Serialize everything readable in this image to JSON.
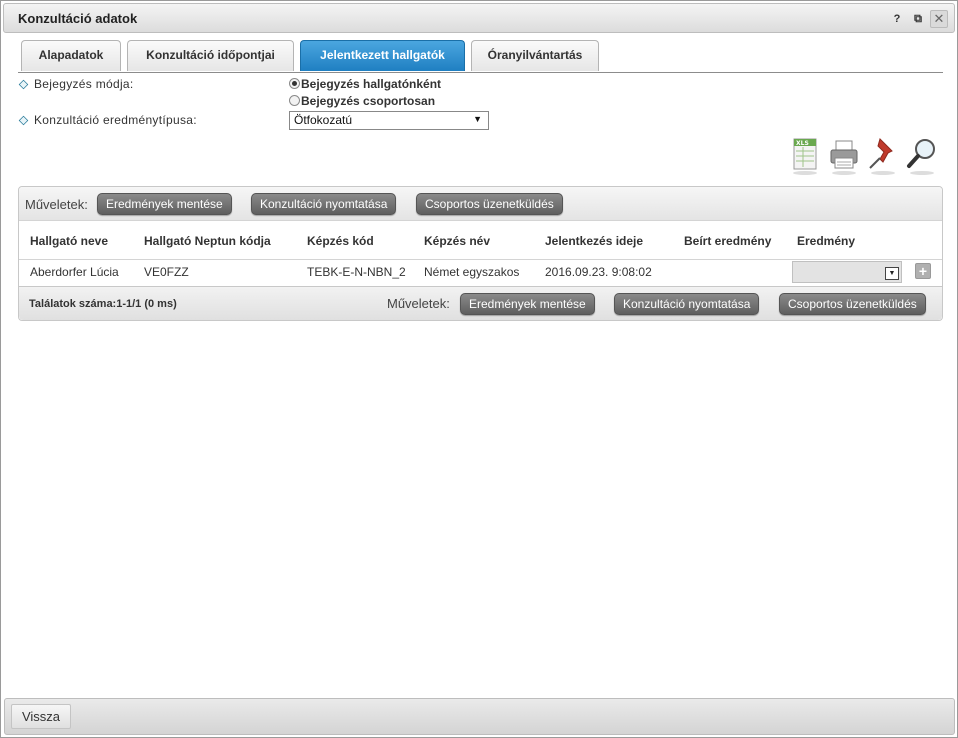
{
  "window": {
    "title": "Konzultáció adatok",
    "help_label": "?",
    "popout_label": "⧉",
    "close_label": "✕"
  },
  "tabs": [
    {
      "label": "Alapadatok",
      "active": false
    },
    {
      "label": "Konzultáció időpontjai",
      "active": false
    },
    {
      "label": "Jelentkezett hallgatók",
      "active": true
    },
    {
      "label": "Óranyilvántartás",
      "active": false
    }
  ],
  "form": {
    "entry_mode_label": "Bejegyzés módja:",
    "entry_mode_options": [
      {
        "label": "Bejegyzés hallgatónként",
        "checked": true
      },
      {
        "label": "Bejegyzés csoportosan",
        "checked": false
      }
    ],
    "result_type_label": "Konzultáció eredménytípusa:",
    "result_type_value": "Ötfokozatú"
  },
  "toolbar_icons": [
    "xls-export-icon",
    "print-icon",
    "pin-icon",
    "search-icon"
  ],
  "operations": {
    "label": "Műveletek:",
    "buttons": [
      "Eredmények mentése",
      "Konzultáció nyomtatása",
      "Csoportos üzenetküldés"
    ]
  },
  "table": {
    "columns": [
      "Hallgató neve",
      "Hallgató Neptun kódja",
      "Képzés kód",
      "Képzés név",
      "Jelentkezés ideje",
      "Beírt eredmény",
      "Eredmény"
    ],
    "rows": [
      {
        "name": "Aberdorfer Lúcia",
        "neptun": "VE0FZZ",
        "program_code": "TEBK-E-N-NBN_2",
        "program_name": "Német egyszakos",
        "applied_at": "2016.09.23. 9:08:02",
        "entered_result": "",
        "result": ""
      }
    ],
    "plus_label": "+"
  },
  "footer": {
    "count_text": "Találatok száma:1-1/1 (0 ms)"
  },
  "bottom": {
    "back_label": "Vissza"
  },
  "colors": {
    "active_tab": "#2a8ad0",
    "op_button": "#6f6f6f"
  }
}
